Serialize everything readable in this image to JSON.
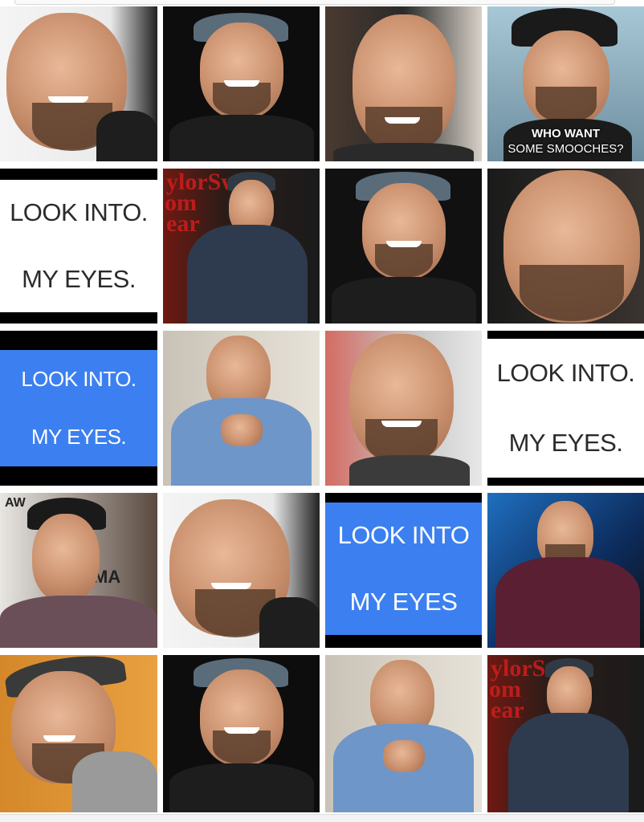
{
  "tiles": {
    "r1c4_caption_line1": "WHO WANT",
    "r1c4_caption_line2": "SOME SMOOCHES?",
    "r2c1_line1": "LOOK INTO.",
    "r2c1_line2": "MY EYES.",
    "r2c2_overlay_line1": "ylorSw",
    "r2c2_overlay_line2": "om",
    "r2c2_overlay_line3": "ear",
    "r3c1_line1": "LOOK INTO.",
    "r3c1_line2": "MY EYES.",
    "r3c4_line1": "LOOK INTO.",
    "r3c4_line2": "MY EYES.",
    "r4c1_overlay_left": "AW",
    "r4c1_overlay_right": "MA",
    "r4c3_line1": "LOOK INTO",
    "r4c3_line2": "MY EYES",
    "r5c4_overlay_line1": "ylorSw",
    "r5c4_overlay_line2": "om",
    "r5c4_overlay_line3": "ear"
  },
  "colors": {
    "blue_tile": "#3b7ff0",
    "white_tile": "#ffffff",
    "text_dark": "#2b2b2b",
    "overlay_red": "#c91d1d"
  }
}
